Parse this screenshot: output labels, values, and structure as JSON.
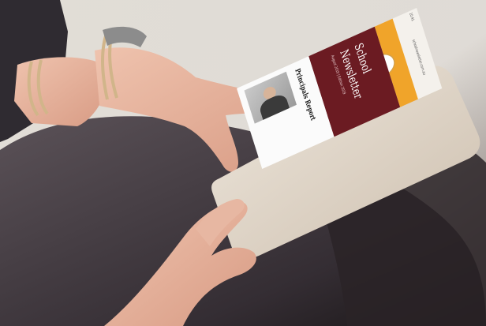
{
  "app": {
    "title_line_1": "School",
    "title_line_2": "Newsletter",
    "dateline": "August 2019 | Edition 2019",
    "section_heading": "Principals Report",
    "status_time": "10:41",
    "status_url": "schoolnewsletter.com.au"
  },
  "icons": {
    "crest": "school-crest-icon"
  },
  "colors": {
    "masthead": "#6b1b22",
    "banner": "#f0a42a",
    "content": "#fbfbfb",
    "scene_background": "#ffffff"
  }
}
